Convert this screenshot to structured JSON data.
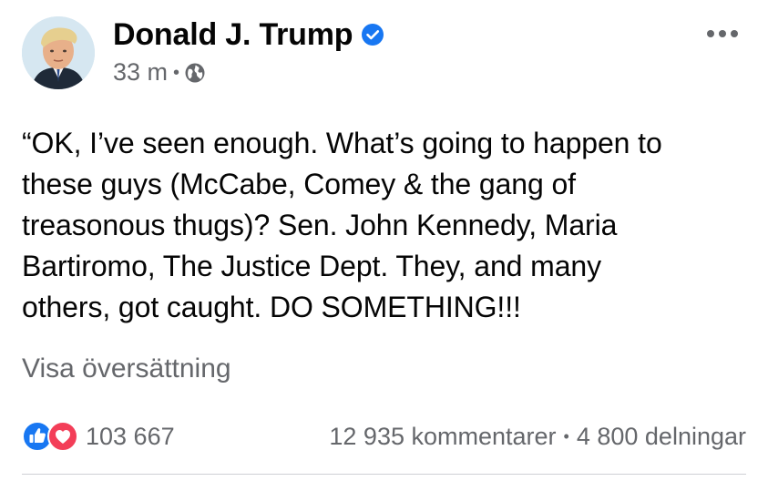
{
  "post": {
    "author": "Donald J. Trump",
    "timestamp": "33 m",
    "meta_separator": "•",
    "privacy_icon": "globe-icon",
    "verified_icon": "verified-badge-icon",
    "more_icon": "more-options-icon",
    "text_lines": [
      "“OK, I’ve seen enough. What’s going to happen to",
      "these guys (McCabe, Comey & the gang of",
      "treasonous thugs)? Sen. John Kennedy, Maria",
      "Bartiromo, The Justice Dept. They, and many",
      "others, got caught. DO SOMETHING!!!"
    ],
    "see_translation": "Visa översättning"
  },
  "stats": {
    "reaction_icons": [
      "like-icon",
      "love-icon"
    ],
    "reactions_count": "103 667",
    "comments": "12 935 kommentarer",
    "separator": "•",
    "shares": "4 800 delningar"
  },
  "colors": {
    "primary_text": "#050505",
    "secondary_text": "#65676b",
    "accent_blue": "#1877f2",
    "love_red": "#f33e58",
    "divider": "#ced0d4"
  }
}
